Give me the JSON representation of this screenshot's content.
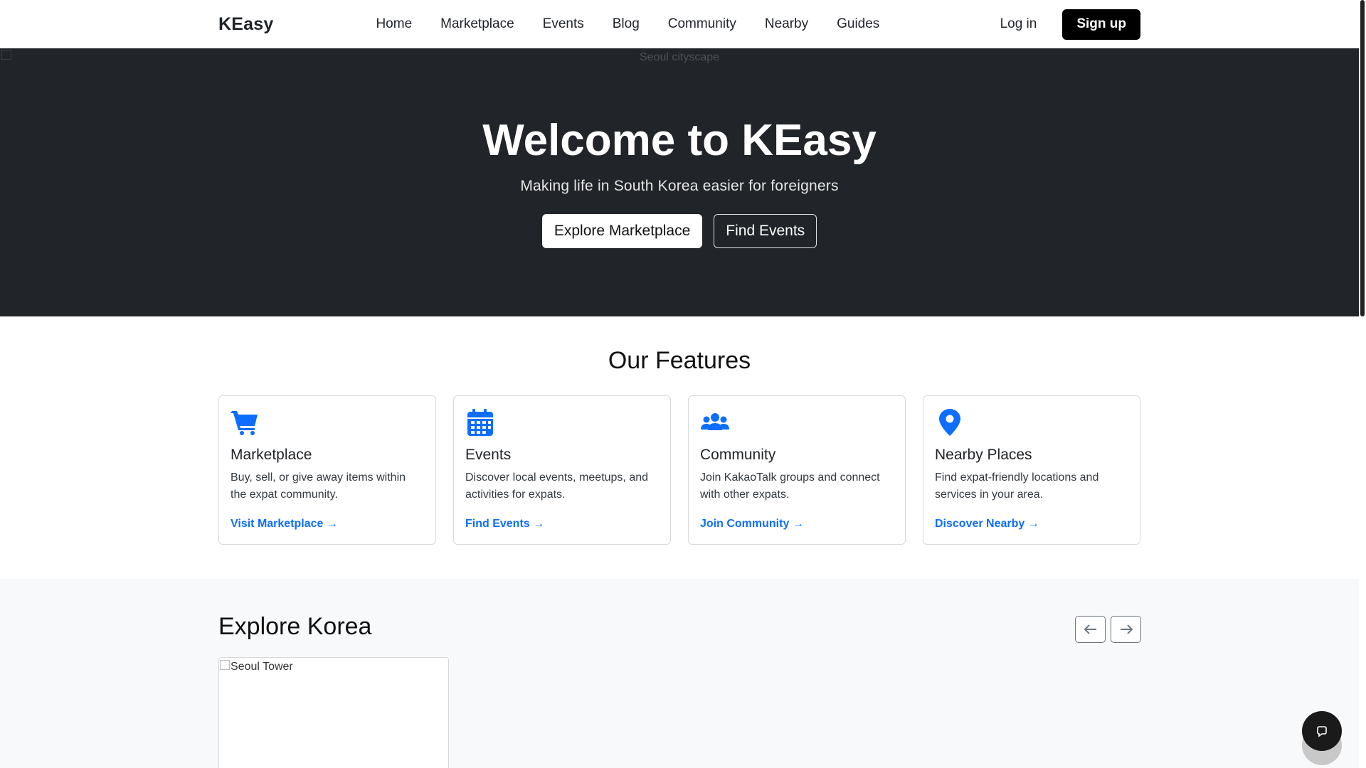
{
  "nav": {
    "brand": "KEasy",
    "links": [
      "Home",
      "Marketplace",
      "Events",
      "Blog",
      "Community",
      "Nearby",
      "Guides"
    ],
    "login": "Log in",
    "signup": "Sign up"
  },
  "hero": {
    "image_alt": "Seoul cityscape",
    "title": "Welcome to KEasy",
    "subtitle": "Making life in South Korea easier for foreigners",
    "primary_button": "Explore Marketplace",
    "secondary_button": "Find Events"
  },
  "features": {
    "title": "Our Features",
    "accent_color": "#0d6efd",
    "cards": [
      {
        "icon": "shopping-cart-icon",
        "title": "Marketplace",
        "description": "Buy, sell, or give away items within the expat community.",
        "link": "Visit Marketplace →"
      },
      {
        "icon": "calendar-icon",
        "title": "Events",
        "description": "Discover local events, meetups, and activities for expats.",
        "link": "Find Events →"
      },
      {
        "icon": "users-icon",
        "title": "Community",
        "description": "Join KakaoTalk groups and connect with other expats.",
        "link": "Join Community →"
      },
      {
        "icon": "map-pin-icon",
        "title": "Nearby Places",
        "description": "Find expat-friendly locations and services in your area.",
        "link": "Discover Nearby →"
      }
    ]
  },
  "explore": {
    "title": "Explore Korea",
    "prev_icon": "arrow-left-icon",
    "next_icon": "arrow-right-icon",
    "slides": [
      {
        "image_alt": "Seoul Tower"
      }
    ]
  },
  "chat_fab": {
    "icon": "chat-icon"
  }
}
